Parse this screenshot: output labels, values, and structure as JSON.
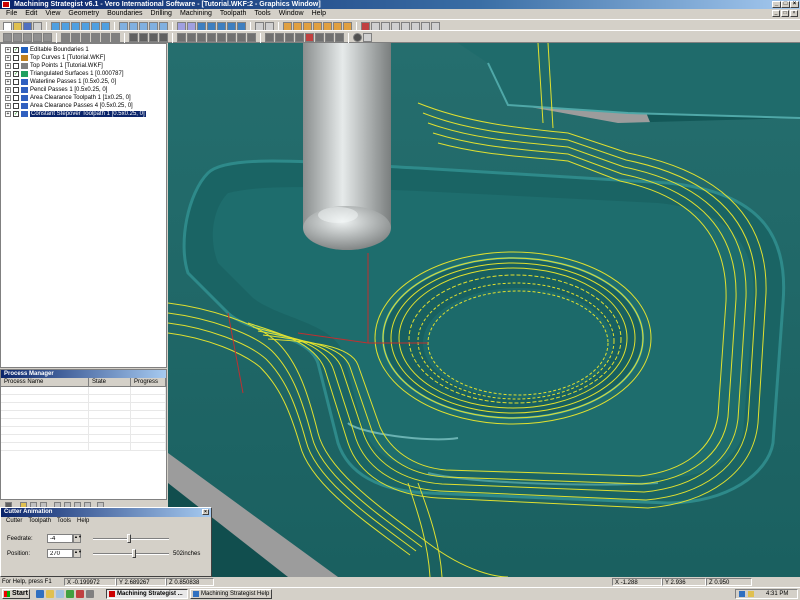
{
  "app": {
    "title": "Machining Strategist v6.1 - Vero International Software - [Tutorial.WKF:2 - Graphics Window]"
  },
  "menu": [
    "File",
    "Edit",
    "View",
    "Geometry",
    "Boundaries",
    "Drilling",
    "Machining",
    "Toolpath",
    "Tools",
    "Window",
    "Help"
  ],
  "tree": {
    "items": [
      {
        "label": "Editable Boundaries 1",
        "checked": true,
        "icon": "boundary-icon",
        "color": "#2060c0"
      },
      {
        "label": "Top Curves 1 [Tutorial.WKF]",
        "checked": false,
        "icon": "curve-icon",
        "color": "#c08020"
      },
      {
        "label": "Top Points 1 [Tutorial.WKF]",
        "checked": false,
        "icon": "points-icon",
        "color": "#808080"
      },
      {
        "label": "Triangulated Surfaces 1 [0.000787]",
        "checked": true,
        "icon": "surface-icon",
        "color": "#20a060"
      },
      {
        "label": "Waterline Passes 1 [0.5x0.25, 0]",
        "checked": false,
        "icon": "toolpath-icon",
        "color": "#3060c0"
      },
      {
        "label": "Pencil Passes 1 [0.5x0.25, 0]",
        "checked": false,
        "icon": "toolpath-icon",
        "color": "#3060c0"
      },
      {
        "label": "Area Clearance Toolpath 1 [1x0.25, 0]",
        "checked": false,
        "icon": "toolpath-icon",
        "color": "#3060c0"
      },
      {
        "label": "Area Clearance Passes 4 [0.5x0.25, 0]",
        "checked": false,
        "icon": "toolpath-icon",
        "color": "#3060c0"
      },
      {
        "label": "Constant Stepover Toolpath 1 [0.5x0.25, 0]",
        "checked": true,
        "icon": "toolpath-icon",
        "color": "#3060c0",
        "selected": true
      }
    ]
  },
  "process_manager": {
    "title": "Process Manager",
    "columns": [
      "Process Name",
      "State",
      "Progress"
    ]
  },
  "cutter_animation": {
    "title": "Cutter Animation",
    "menu": [
      "Cutter",
      "Toolpath",
      "Tools",
      "Help"
    ],
    "feedrate_label": "Feedrate:",
    "feedrate_value": "-4",
    "position_label": "Position:",
    "position_value": "270",
    "position_units": "502inches",
    "feedrate_slider": 0.48,
    "position_slider": 0.54
  },
  "status": {
    "help": "For Help, press F1",
    "coords1": [
      "X -0.199972",
      "Y 2.689267",
      "Z 0.850838"
    ],
    "coords2": [
      "X -1.288",
      "Y 2.936",
      "Z 0.950"
    ]
  },
  "taskbar": {
    "start": "Start",
    "tasks": [
      "Machining Strategist ...",
      "Machining Strategist Help"
    ],
    "clock": "4:31 PM"
  },
  "colors": {
    "model": "#1e7878",
    "toolpath": "#e0e030",
    "cutter": "#b4b8b8",
    "selection": "#0a246a"
  }
}
